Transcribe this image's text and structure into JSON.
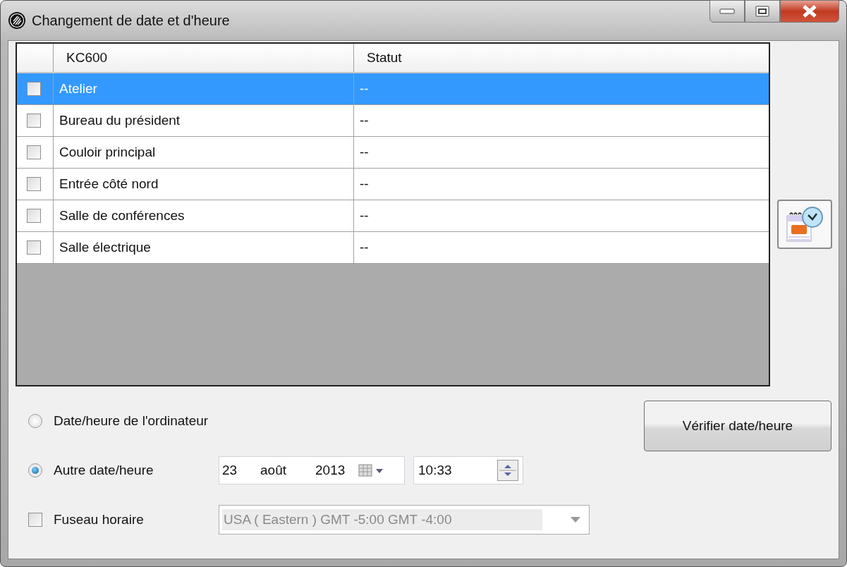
{
  "window": {
    "title": "Changement de date et d'heure"
  },
  "table": {
    "columns": [
      "KC600",
      "Statut"
    ],
    "rows": [
      {
        "name": "Atelier",
        "status": "--",
        "checked": false,
        "selected": true
      },
      {
        "name": "Bureau du président",
        "status": "--",
        "checked": false,
        "selected": false
      },
      {
        "name": "Couloir principal",
        "status": "--",
        "checked": false,
        "selected": false
      },
      {
        "name": "Entrée côté nord",
        "status": "--",
        "checked": false,
        "selected": false
      },
      {
        "name": "Salle de conférences",
        "status": "--",
        "checked": false,
        "selected": false
      },
      {
        "name": "Salle électrique",
        "status": "--",
        "checked": false,
        "selected": false
      }
    ]
  },
  "source_options": [
    {
      "label": "Date/heure de l'ordinateur",
      "selected": false
    },
    {
      "label": "Autre date/heure",
      "selected": true
    }
  ],
  "date": {
    "day": "23",
    "month": "août",
    "year": "2013"
  },
  "time": "10:33",
  "verify_button": "Vérifier date/heure",
  "timezone": {
    "label": "Fuseau horaire",
    "checked": false,
    "value": "USA ( Eastern ) GMT -5:00 GMT -4:00",
    "disabled": true
  }
}
